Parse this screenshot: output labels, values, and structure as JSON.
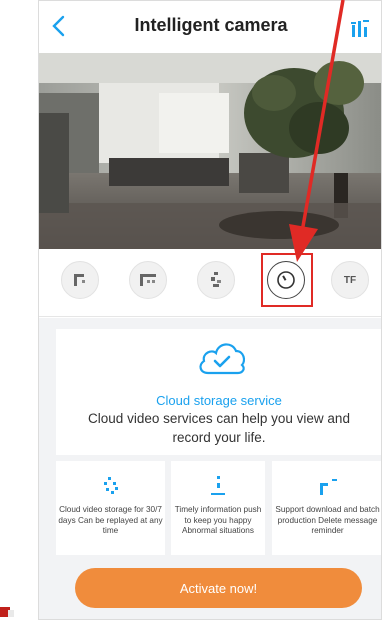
{
  "header": {
    "title": "Intelligent camera",
    "back_icon": "chevron-left-icon",
    "settings_icon": "settings-icon"
  },
  "controls": {
    "items": [
      {
        "icon": "screenshot-icon"
      },
      {
        "icon": "record-icon"
      },
      {
        "icon": "intercom-icon"
      },
      {
        "icon": "cloud-record-icon",
        "active": true
      },
      {
        "icon": "tf-card-icon",
        "label": "TF"
      }
    ]
  },
  "cloud": {
    "title": "Cloud storage service",
    "description": "Cloud video services can help you view and record your life."
  },
  "features": [
    {
      "icon": "cloud-storage-icon",
      "text": "Cloud video storage for 30/7 days Can be replayed at any time"
    },
    {
      "icon": "push-icon",
      "text": "Timely information push to keep you happy Abnormal situations"
    },
    {
      "icon": "download-icon",
      "text": "Support download and batch production Delete message reminder"
    }
  ],
  "activate_label": "Activate now!",
  "colors": {
    "accent": "#1aa1ee",
    "button": "#f08c3c",
    "annotation": "#e02a25"
  }
}
